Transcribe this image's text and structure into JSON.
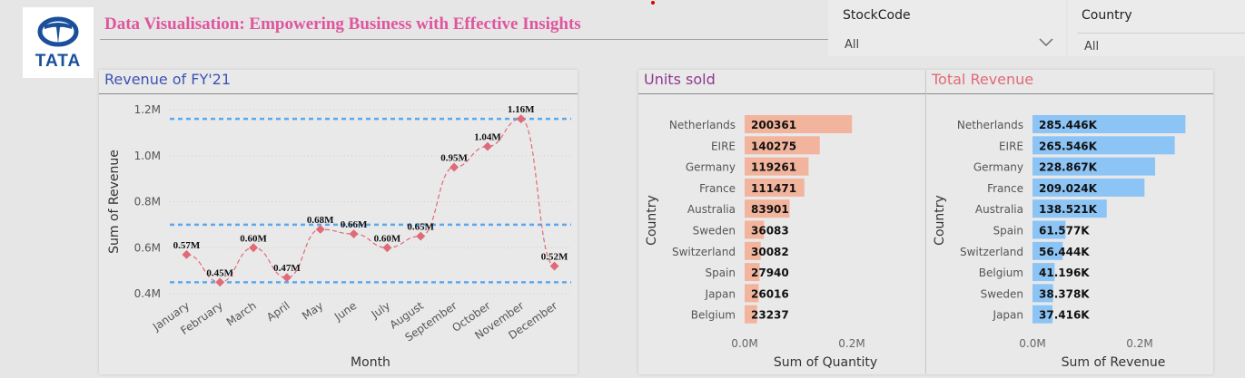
{
  "brand": {
    "logo_text": "TATA",
    "logo_color": "#1a4f9c"
  },
  "header": {
    "title": "Data Visualisation: Empowering Business with Effective Insights",
    "title_color": "#e0559e"
  },
  "slicers": [
    {
      "title": "StockCode",
      "value": "All",
      "icon": "chevron-down-icon"
    },
    {
      "title": "Country",
      "value": "All"
    }
  ],
  "colors": {
    "line": "#e06a78",
    "reference": "#5aa8f0",
    "units_bar": "#f2b49c",
    "revenue_bar": "#8cc4f5"
  },
  "panels": {
    "revenue": {
      "title": "Revenue of FY'21",
      "title_color": "#3f51b5"
    },
    "units": {
      "title": "Units sold",
      "title_color": "#8e3a8e"
    },
    "total": {
      "title": "Total Revenue",
      "title_color": "#e06a78"
    }
  },
  "chart_data": [
    {
      "type": "line",
      "title": "Revenue of FY'21",
      "xlabel": "Month",
      "ylabel": "Sum of Revenue",
      "categories": [
        "January",
        "February",
        "March",
        "April",
        "May",
        "June",
        "July",
        "August",
        "September",
        "October",
        "November",
        "December"
      ],
      "values": [
        0.57,
        0.45,
        0.6,
        0.47,
        0.68,
        0.66,
        0.6,
        0.65,
        0.95,
        1.04,
        1.16,
        0.52
      ],
      "data_labels": [
        "0.57M",
        "0.45M",
        "0.60M",
        "0.47M",
        "0.68M",
        "0.66M",
        "0.60M",
        "0.65M",
        "0.95M",
        "1.04M",
        "1.16M",
        "0.52M"
      ],
      "ylim": [
        0.4,
        1.2
      ],
      "yticks": [
        0.4,
        0.6,
        0.8,
        1.0,
        1.2
      ],
      "ytick_labels": [
        "0.4M",
        "0.6M",
        "0.8M",
        "1.0M",
        "1.2M"
      ],
      "reference_lines": [
        1.16,
        0.7,
        0.45
      ],
      "grid": true
    },
    {
      "type": "bar",
      "orientation": "horizontal",
      "title": "Units sold",
      "xlabel": "Sum of Quantity",
      "ylabel": "Country",
      "categories": [
        "Netherlands",
        "EIRE",
        "Germany",
        "France",
        "Australia",
        "Sweden",
        "Switzerland",
        "Spain",
        "Japan",
        "Belgium"
      ],
      "values": [
        200361,
        140275,
        119261,
        111471,
        83901,
        36083,
        30082,
        27940,
        26016,
        23237
      ],
      "data_labels": [
        "200361",
        "140275",
        "119261",
        "111471",
        "83901",
        "36083",
        "30082",
        "27940",
        "26016",
        "23237"
      ],
      "xlim": [
        0,
        200000
      ],
      "xticks": [
        0,
        200000
      ],
      "xtick_labels": [
        "0.0M",
        "0.2M"
      ]
    },
    {
      "type": "bar",
      "orientation": "horizontal",
      "title": "Total Revenue",
      "xlabel": "Sum of Revenue",
      "ylabel": "Country",
      "categories": [
        "Netherlands",
        "EIRE",
        "Germany",
        "France",
        "Australia",
        "Spain",
        "Switzerland",
        "Belgium",
        "Sweden",
        "Japan"
      ],
      "values": [
        285446,
        265546,
        228867,
        209024,
        138521,
        61577,
        56444,
        41196,
        38378,
        37416
      ],
      "data_labels": [
        "285.446K",
        "265.546K",
        "228.867K",
        "209.024K",
        "138.521K",
        "61.577K",
        "56.444K",
        "41.196K",
        "38.378K",
        "37.416K"
      ],
      "xlim": [
        0,
        200000
      ],
      "xticks": [
        0,
        200000
      ],
      "xtick_labels": [
        "0.0M",
        "0.2M"
      ]
    }
  ]
}
